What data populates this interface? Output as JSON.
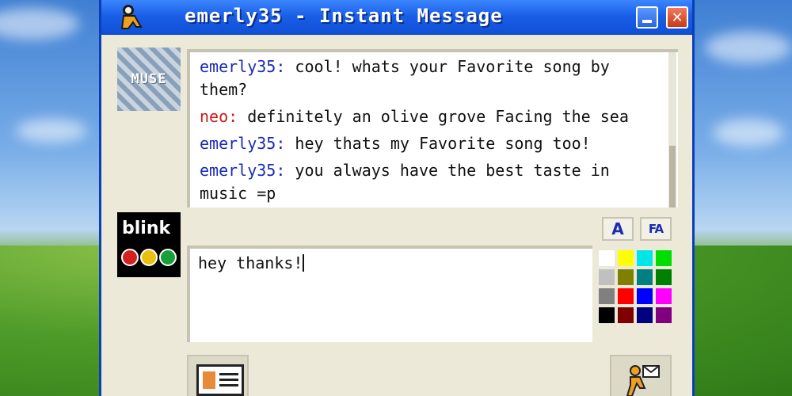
{
  "window": {
    "title": "emerly35 - Instant Message"
  },
  "avatars": {
    "buddy": "MUSE",
    "self": "blink"
  },
  "chat": {
    "messages": [
      {
        "sender": "emerly35:",
        "text": " cool! whats your Favorite song by them?",
        "color": "blue"
      },
      {
        "sender": "neo:",
        "text": " definitely an olive grove Facing the sea",
        "color": "red"
      },
      {
        "sender": "emerly35:",
        "text": " hey thats my Favorite song too!",
        "color": "blue"
      },
      {
        "sender": "emerly35:",
        "text": " you always have the best taste in music =p",
        "color": "blue"
      }
    ]
  },
  "format": {
    "text_button": "A",
    "font_button": "FA"
  },
  "compose": {
    "value": "hey thanks!"
  },
  "palette": {
    "colors": [
      "#ffffff",
      "#ffff00",
      "#00e5e5",
      "#00dd00",
      "#c0c0c0",
      "#808000",
      "#008080",
      "#008000",
      "#808080",
      "#ff0000",
      "#0000ff",
      "#ff00ff",
      "#000000",
      "#800000",
      "#000080",
      "#800080"
    ]
  }
}
